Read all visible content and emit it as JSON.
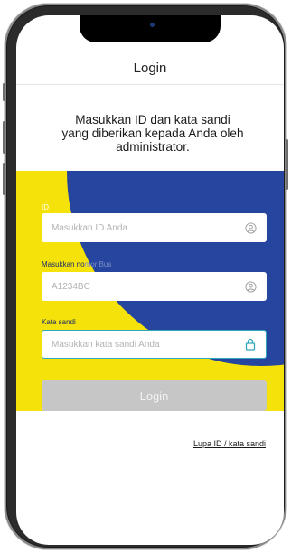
{
  "header": {
    "title": "Login"
  },
  "intro": {
    "line1": "Masukkan ID dan kata sandi",
    "line2": "yang diberikan kepada Anda oleh",
    "line3": "administrator."
  },
  "form": {
    "id_label": "ID",
    "id_placeholder": "Masukkan ID Anda",
    "bus_label_part1": "Masukkan no",
    "bus_label_part2": "mor Bus",
    "bus_value": "A1234BC",
    "password_label": "Kata sandi",
    "password_placeholder": "Masukkan kata sandi Anda",
    "login_label": "Login"
  },
  "links": {
    "forgot": "Lupa ID / kata sandi"
  },
  "colors": {
    "yellow": "#f5e20a",
    "blue": "#25459e",
    "focus_border": "#2da7b9",
    "button_disabled": "#c6c6c6"
  },
  "icons": {
    "id_field": "user-circle-icon",
    "bus_field": "user-circle-icon",
    "password_field": "lock-icon"
  }
}
